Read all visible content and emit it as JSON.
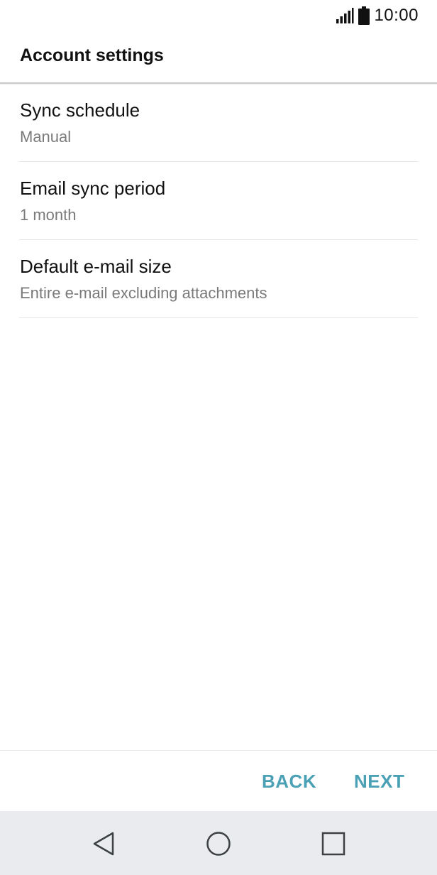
{
  "status_bar": {
    "time": "10:00",
    "signal_icon": "signal-icon",
    "battery_icon": "battery-icon"
  },
  "header": {
    "title": "Account settings"
  },
  "settings": {
    "items": [
      {
        "title": "Sync schedule",
        "value": "Manual"
      },
      {
        "title": "Email sync period",
        "value": "1 month"
      },
      {
        "title": "Default e-mail size",
        "value": "Entire e-mail excluding attachments"
      }
    ]
  },
  "actions": {
    "back_label": "BACK",
    "next_label": "NEXT",
    "accent_color": "#4aa1b5"
  },
  "nav_bar": {
    "back_icon": "triangle-back-icon",
    "home_icon": "circle-home-icon",
    "recent_icon": "square-recent-icon"
  }
}
